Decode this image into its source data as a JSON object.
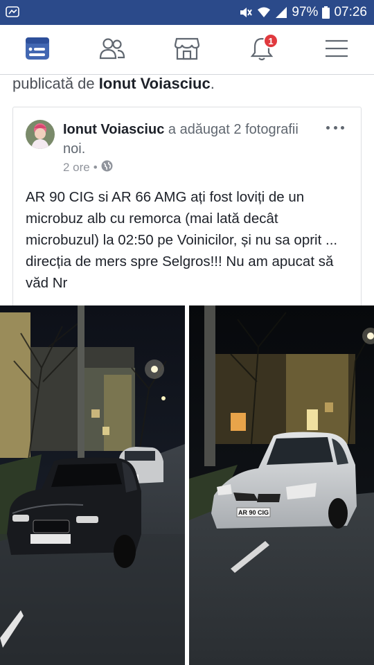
{
  "status_bar": {
    "battery": "97%",
    "time": "07:26"
  },
  "nav": {
    "notification_count": "1"
  },
  "share_line": {
    "prefix": "publicată de ",
    "author": "Ionut Voiasciuc",
    "suffix": "."
  },
  "post": {
    "author": "Ionut Voiasciuc",
    "action": " a adăugat 2 fotografii noi.",
    "time": "2 ore",
    "separator": "•",
    "text": "AR 90 CIG si AR 66 AMG ați fost loviți de un microbuz alb cu remorca (mai lată decât microbuzul) la 02:50 pe Voinicilor, și nu sa oprit ... direcția de mers spre Selgros!!! Nu am apucat să văd Nr"
  },
  "photos": {
    "right_plate": "AR 90 CIG"
  }
}
